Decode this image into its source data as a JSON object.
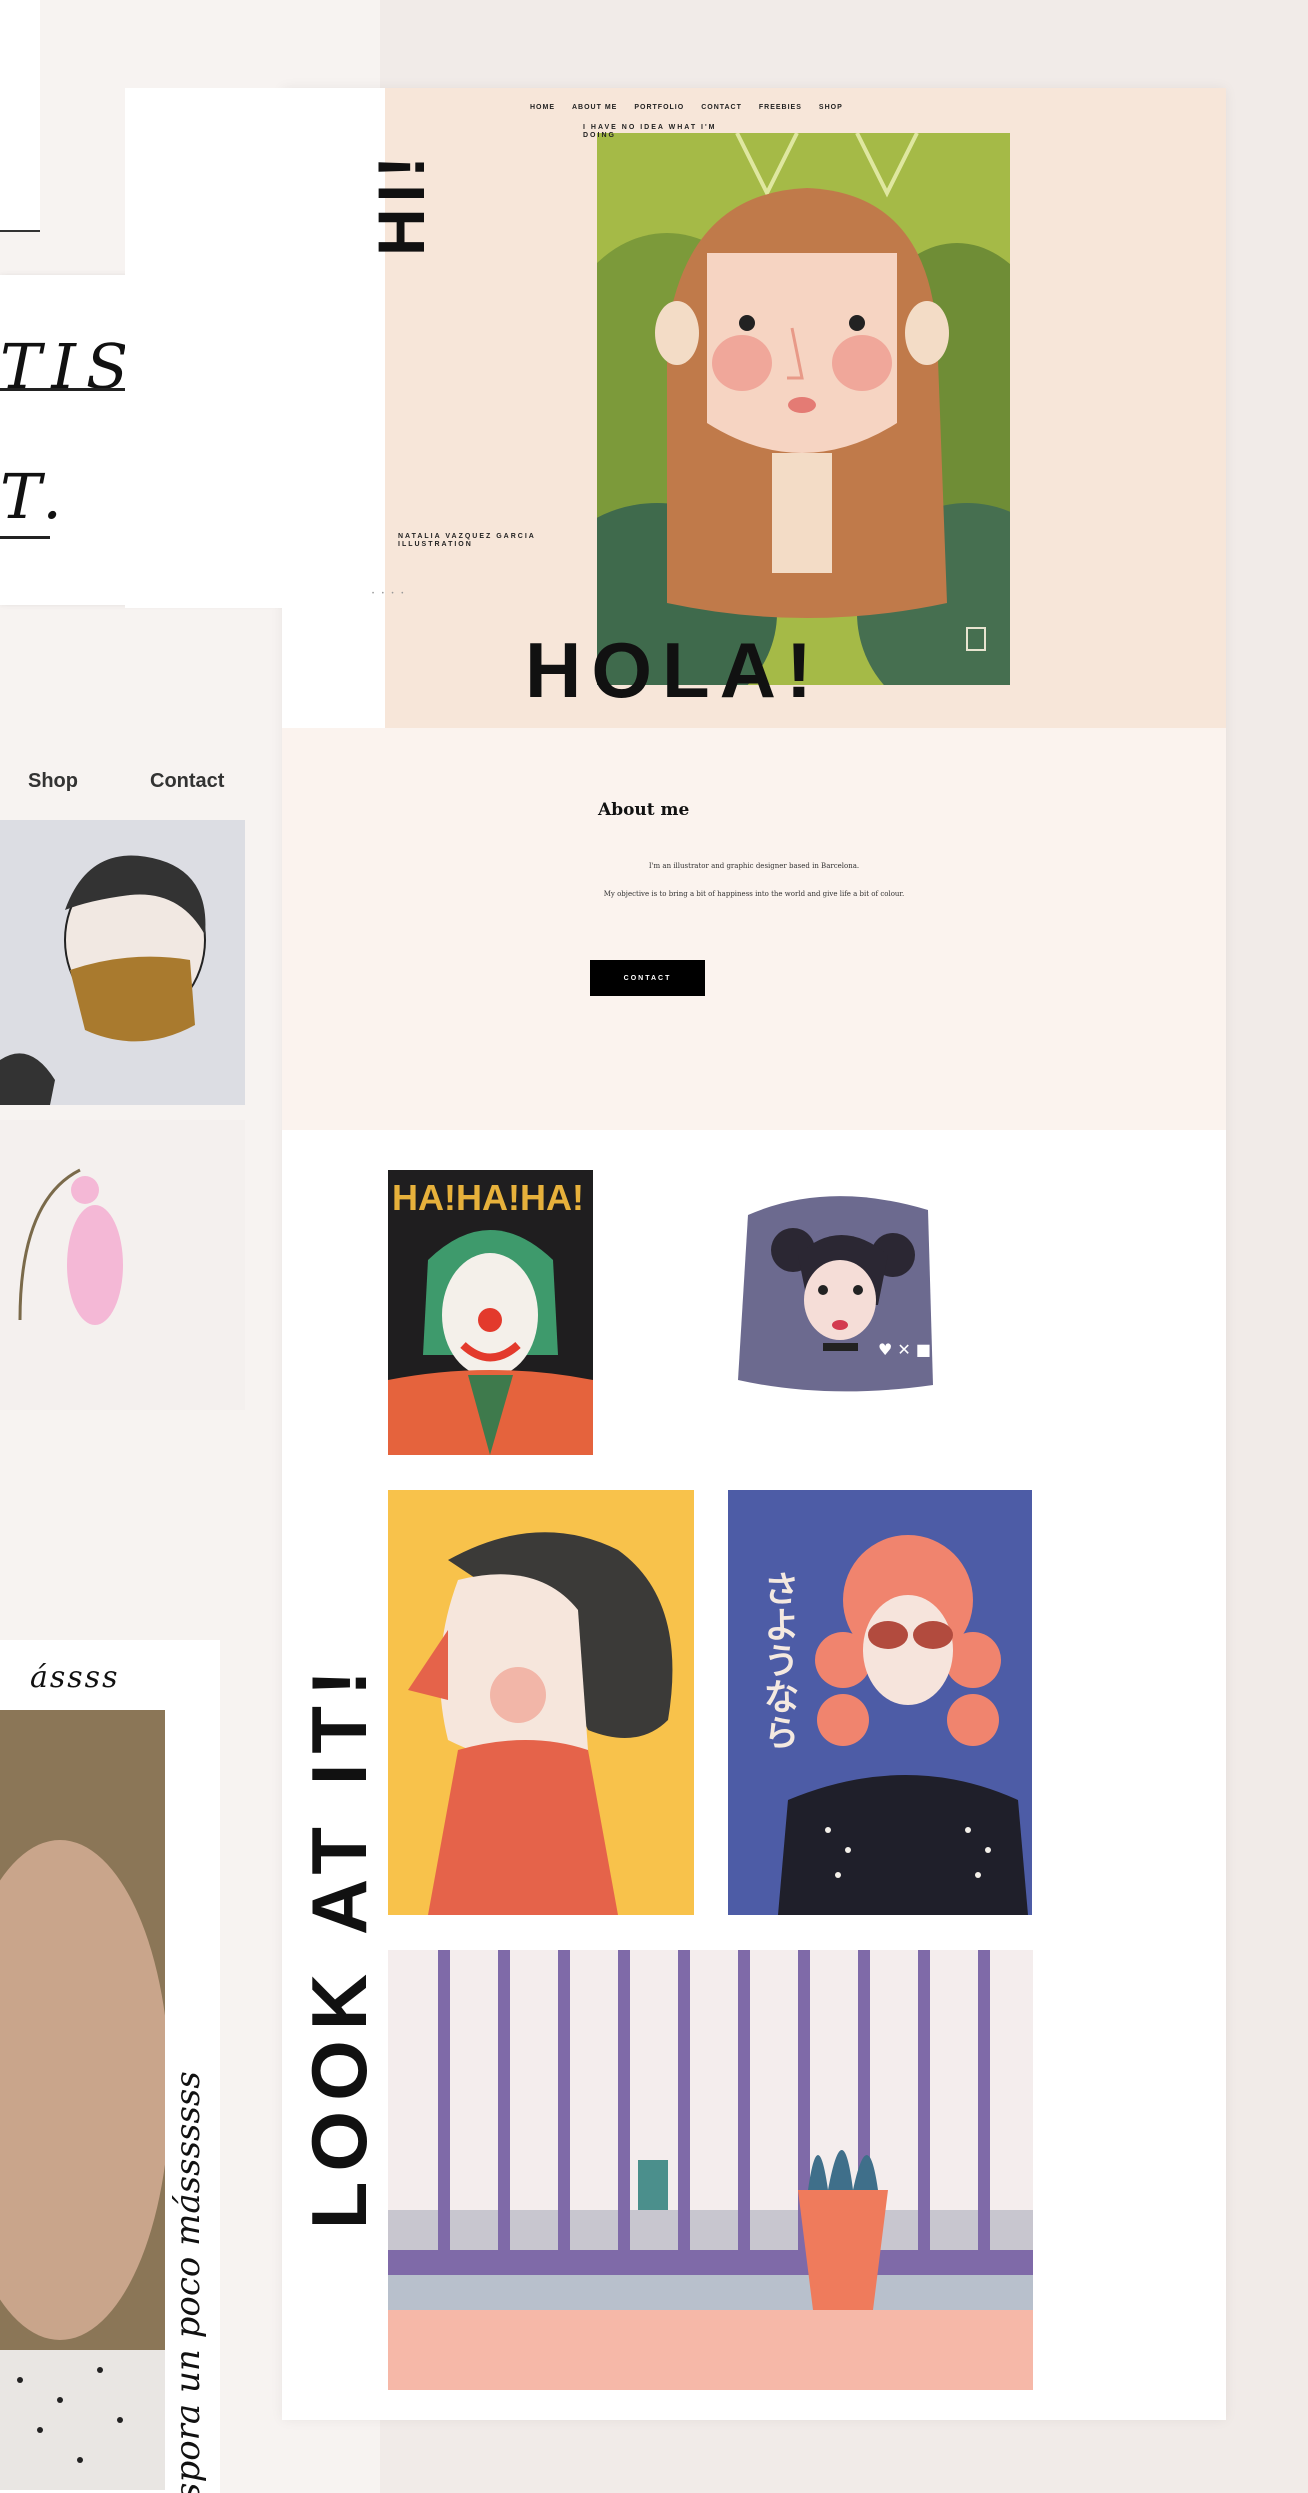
{
  "left": {
    "hand_line1": "TIST.",
    "hand_line2": "T.",
    "nav": [
      "Shop",
      "Contact"
    ],
    "script_top": "ássss",
    "script_vertical": "spora un poco másssssss"
  },
  "site": {
    "nav": [
      "HOME",
      "ABOUT ME",
      "PORTFOLIO",
      "CONTACT",
      "FREEBIES",
      "SHOP"
    ],
    "tagline": "I HAVE NO IDEA WHAT I'M DOING",
    "hi": "HI!",
    "author": "NATALIA VAZQUEZ GARCIA ILLUSTRATION",
    "side_dots": "• • • •",
    "hola": "HOLA!",
    "about": {
      "title": "About me",
      "line1": "I'm an illustrator and graphic designer based in Barcelona.",
      "line2": "My objective is to bring a bit of happiness into the world and give life a bit of colour.",
      "button": "CONTACT"
    },
    "look": "LOOK AT IT!",
    "art": {
      "joker_text": "HA!HA!HA!",
      "sayonara_text": "さようなら"
    }
  },
  "colors": {
    "hero_bg": "#f7e6d9",
    "about_bg": "#fbf3ee",
    "hero_green": "#a5ba47",
    "button": "#000000"
  }
}
